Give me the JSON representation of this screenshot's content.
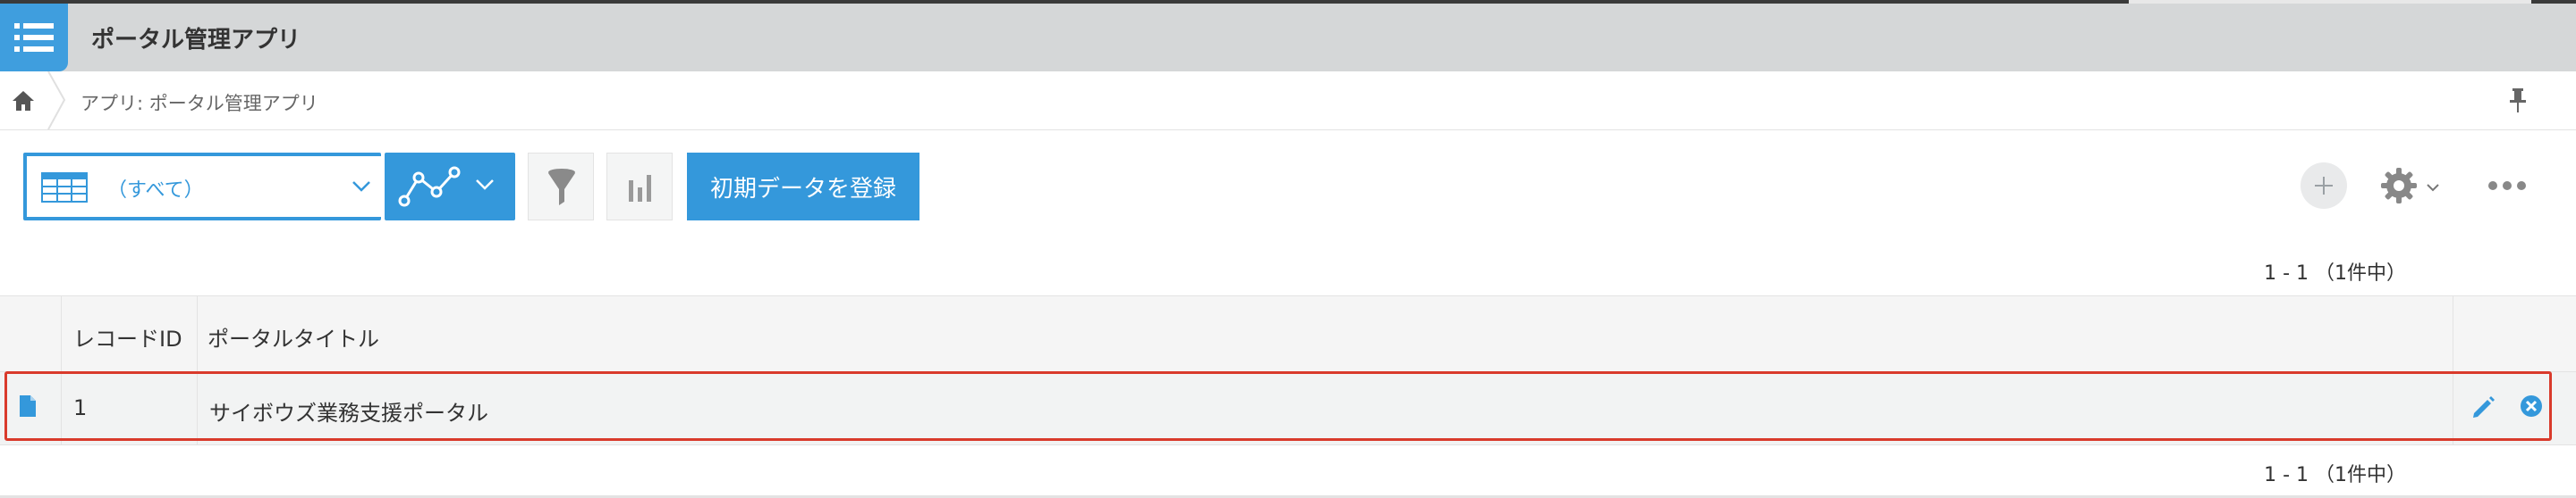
{
  "app": {
    "title": "ポータル管理アプリ"
  },
  "breadcrumb": {
    "text": "アプリ: ポータル管理アプリ"
  },
  "icons": {
    "app": "list-icon",
    "home": "home-icon",
    "pin": "pin-icon",
    "view": "table-icon",
    "graph": "line-chart-icon",
    "filter": "funnel-icon",
    "chart": "bar-chart-icon",
    "add": "plus-icon",
    "settings": "gear-icon",
    "more": "ellipsis-icon",
    "row": "document-icon",
    "edit": "pencil-icon",
    "delete": "close-circle-icon"
  },
  "toolbar": {
    "view_label": "（すべて）",
    "register_button": "初期データを登録"
  },
  "pagination": {
    "top": "1 - 1 （1件中）",
    "bottom": "1 - 1 （1件中）"
  },
  "table": {
    "columns": [
      "レコードID",
      "ポータルタイトル"
    ],
    "rows": [
      {
        "id": "1",
        "title": "サイボウズ業務支援ポータル"
      }
    ]
  },
  "colors": {
    "accent": "#3498db",
    "header_bg": "#d5d7d8",
    "highlight_outline": "#d93a2b"
  }
}
